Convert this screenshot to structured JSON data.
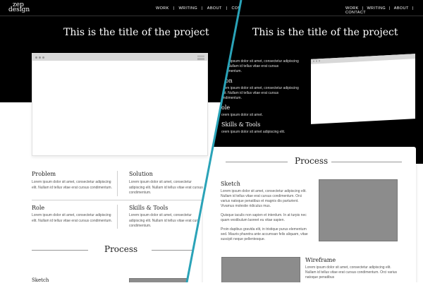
{
  "brand": {
    "logo_line1": "zep",
    "logo_line2": "design"
  },
  "nav": {
    "work": "WORK",
    "writing": "WRITING",
    "about": "ABOUT",
    "contact": "CONTACT",
    "sep": "|"
  },
  "project": {
    "title": "This is the title of the project"
  },
  "details": [
    {
      "heading": "Problem",
      "text": "Lorem ipsum dolor sit amet, consectetur adipiscing elit. Nullam id tellus vitae erat cursus condimentum."
    },
    {
      "heading": "Solution",
      "text": "Lorem ipsum dolor sit amet, consectetur adipiscing elit. Nullam id tellus vitae erat cursus condimentum."
    },
    {
      "heading": "Role",
      "text": "Lorem ipsum dolor sit amet, consectetur adipiscing elit. Nullam id tellus vitae erat cursus condimentum."
    },
    {
      "heading": "Skills & Tools",
      "text": "Lorem ipsum dolor sit amet, consectetur adipiscing elit. Nullam id tellus vitae erat cursus condimentum."
    }
  ],
  "right_details": [
    {
      "heading": "em",
      "text": "orem ipsum dolor sit amet, consectetur adipiscing elit. Nullam id tellus vitae erat cursus ondimentum."
    },
    {
      "heading": "tion",
      "text": "orem ipsum dolor sit amet, consectetur adipiscing elit. Nullam id tellus vitae erat cursus ondimentum."
    },
    {
      "heading": "ole",
      "text": "orem ipsum dolor sit amet."
    },
    {
      "heading": "Skills & Tools",
      "text": "orem ipsum dolor sit amet adipiscing elit."
    }
  ],
  "process": {
    "heading": "Process"
  },
  "sketch": {
    "heading": "Sketch",
    "left_heading": "Sketch",
    "p1": "Lorem ipsum dolor sit amet, consectetur adipiscing elit. Nullam id tellus vitae erat cursus condimentum. Orci varius natoque penatibus et magnis dis parturient. Vivamus molestie ridiculus mus.",
    "p2": "Quisque iaculis non sapien et interdum. In at turpis nec quam vestibulum laoreet eu vitae sapien.",
    "p3": "Proin dapibus gravida elit, in tristique purus elementum sed. Mauris pharetra ante accumsan felis aliquam, vitae suscipit neque pellentesque."
  },
  "wireframe": {
    "heading": "Wireframe",
    "text": "Lorem ipsum dolor sit amet, consectetur adipiscing elit. Nullam id tellus vitae erat cursus condimentum. Orci varius natoque penatibus"
  },
  "colors": {
    "accent": "#2aa3b8",
    "black": "#000000",
    "gray_image": "#8c8c8c"
  }
}
